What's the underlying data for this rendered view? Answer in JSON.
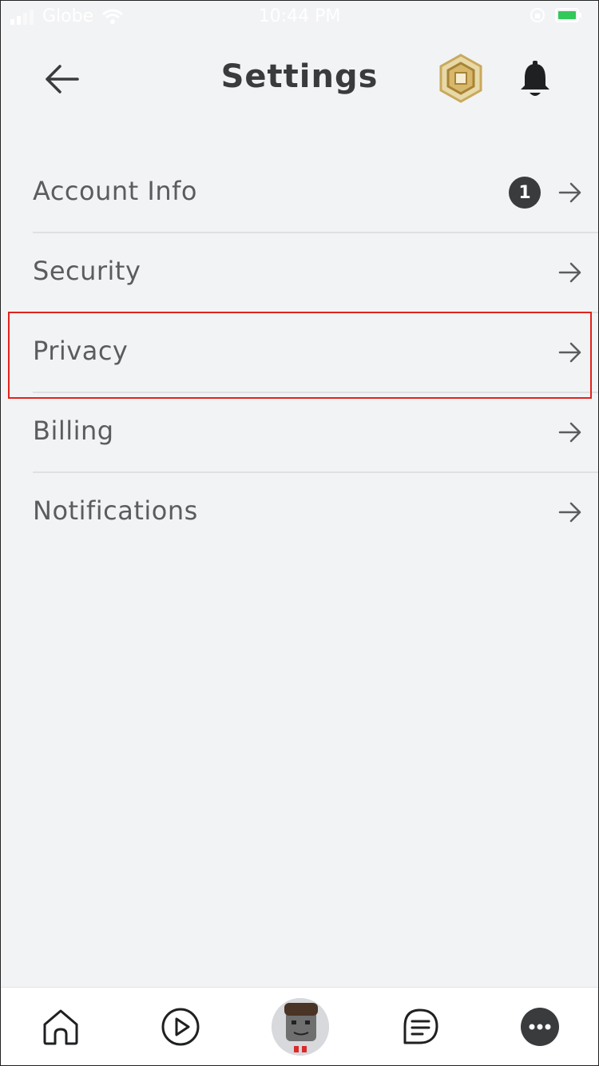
{
  "status_bar": {
    "carrier": "Globe",
    "time": "10:44 PM"
  },
  "header": {
    "title": "Settings"
  },
  "menu": {
    "items": [
      {
        "label": "Account Info",
        "badge": "1"
      },
      {
        "label": "Security"
      },
      {
        "label": "Privacy"
      },
      {
        "label": "Billing"
      },
      {
        "label": "Notifications"
      }
    ]
  },
  "colors": {
    "background": "#f2f3f5",
    "text": "#5a5c5e",
    "highlight": "#e2231a",
    "badge": "#393b3d"
  },
  "icons": {
    "back": "arrow-left-icon",
    "robux": "robux-icon",
    "bell": "bell-icon",
    "arrow": "arrow-right-icon",
    "tabs": [
      "home-icon",
      "play-icon",
      "avatar",
      "chat-icon",
      "more-icon"
    ]
  }
}
